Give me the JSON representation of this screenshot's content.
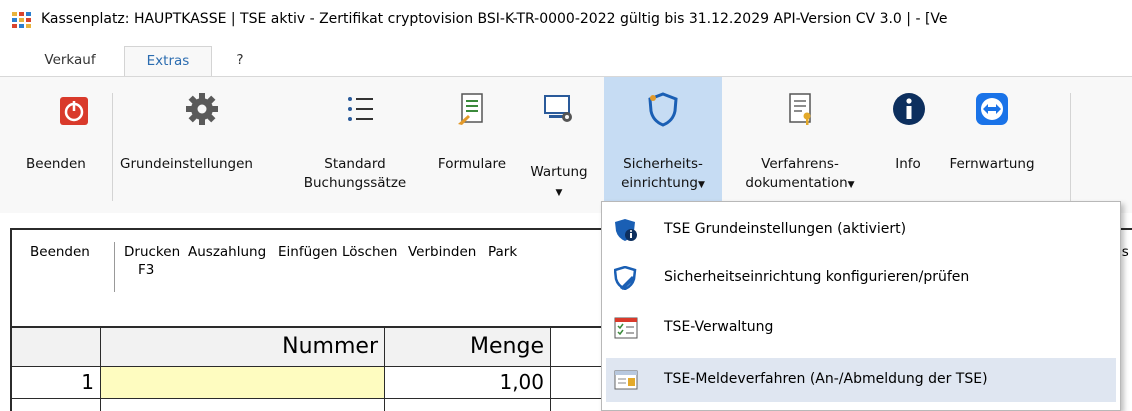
{
  "window": {
    "title": "Kassenplatz: HAUPTKASSE | TSE aktiv - Zertifikat cryptovision BSI-K-TR-0000-2022 gültig bis 31.12.2029 API-Version CV 3.0 |  - [Ve"
  },
  "tabs": [
    {
      "label": "Verkauf"
    },
    {
      "label": "Extras"
    },
    {
      "label": "?"
    }
  ],
  "ribbon": {
    "beenden": {
      "label": "Beenden",
      "icon": "power-icon"
    },
    "grundeinstellungen": {
      "label": "Grundeinstellungen",
      "icon": "gear-icon"
    },
    "standard": {
      "label1": "Standard",
      "label2": "Buchungssätze",
      "icon": "list-icon"
    },
    "formulare": {
      "label": "Formulare",
      "icon": "form-icon"
    },
    "wartung": {
      "label": "Wartung",
      "icon": "maintenance-icon"
    },
    "sicherheit": {
      "label1": "Sicherheits-",
      "label2": "einrichtung",
      "icon": "shield-icon"
    },
    "verfahren": {
      "label1": "Verfahrens-",
      "label2": "dokumentation",
      "icon": "document-key-icon"
    },
    "info": {
      "label": "Info",
      "icon": "info-icon"
    },
    "fernwartung": {
      "label": "Fernwartung",
      "icon": "remote-icon"
    }
  },
  "toolbar2": {
    "items": [
      "Beenden",
      "Drucken",
      "Auszahlung",
      "Einfügen",
      "Löschen",
      "Verbinden",
      "Park"
    ],
    "sub": "F3",
    "right_fragment": "is"
  },
  "grid": {
    "headers": {
      "nummer": "Nummer",
      "menge": "Menge"
    },
    "row1": {
      "pos": "1",
      "nummer": "",
      "menge": "1,00"
    }
  },
  "dropdown": {
    "items": [
      {
        "label": "TSE Grundeinstellungen (aktiviert)",
        "icon": "shield-info-icon"
      },
      {
        "label": "Sicherheitseinrichtung konfigurieren/prüfen",
        "icon": "shield-edit-icon"
      },
      {
        "label": "TSE-Verwaltung",
        "icon": "checklist-icon"
      },
      {
        "label": "TSE-Meldeverfahren (An-/Abmeldung der TSE)",
        "icon": "report-form-icon"
      }
    ]
  },
  "colors": {
    "accent": "#2b6cb0",
    "highlight": "#c6dcf3",
    "input_yellow": "#fefcc0"
  }
}
